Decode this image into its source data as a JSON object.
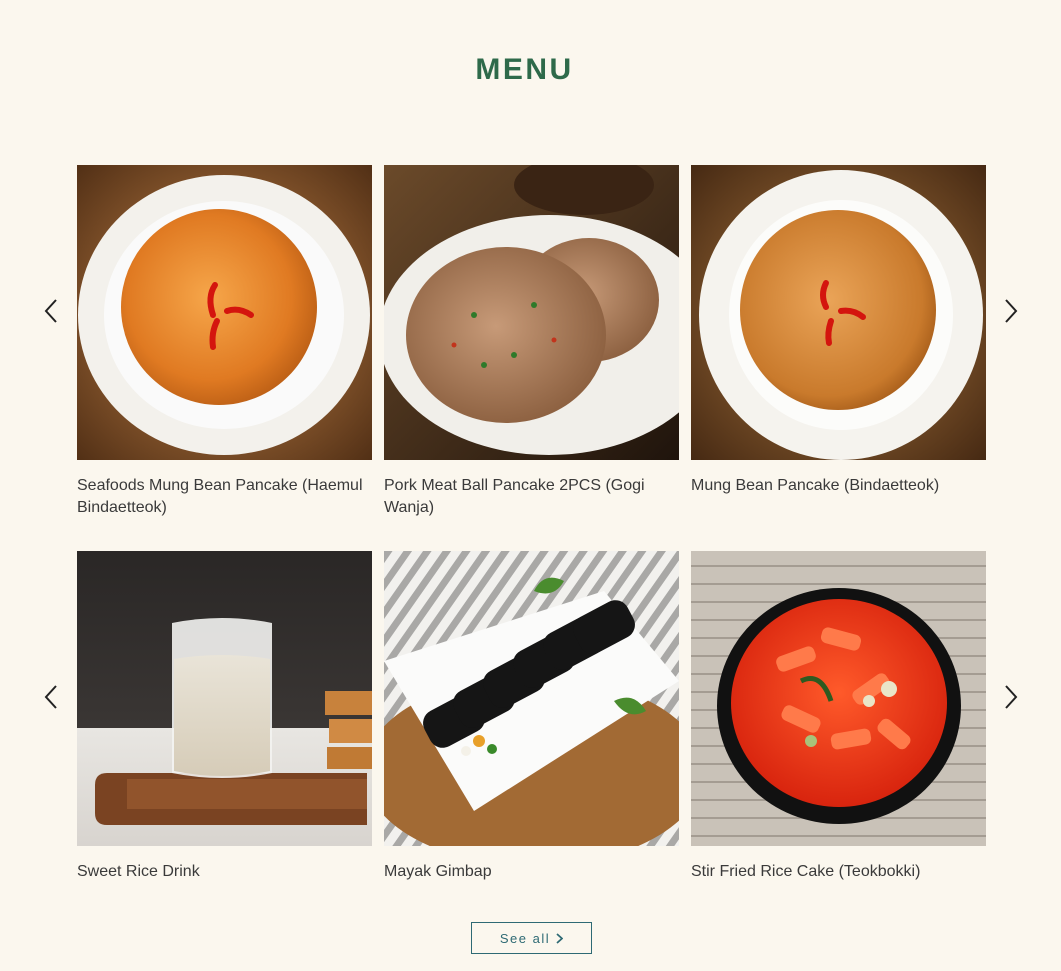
{
  "page": {
    "title": "MENU"
  },
  "carousels": [
    {
      "items": [
        {
          "title": "Seafoods Mung Bean Pancake (Haemul Bindaetteok)",
          "image": "seafood-pancake-photo"
        },
        {
          "title": "Pork Meat Ball Pancake 2PCS (Gogi Wanja)",
          "image": "meatball-pancake-photo"
        },
        {
          "title": "Mung Bean Pancake (Bindaetteok)",
          "image": "mung-bean-pancake-photo"
        }
      ]
    },
    {
      "items": [
        {
          "title": "Sweet Rice Drink",
          "image": "sweet-rice-drink-photo"
        },
        {
          "title": "Mayak Gimbap",
          "image": "mayak-gimbap-photo"
        },
        {
          "title": "Stir Fried Rice Cake (Teokbokki)",
          "image": "teokbokki-photo"
        }
      ]
    }
  ],
  "see_all": {
    "label": "See all",
    "icon": "chevron-right-icon"
  },
  "icons": {
    "prev": "chevron-left-icon",
    "next": "chevron-right-icon"
  },
  "colors": {
    "background": "#fbf7ee",
    "title": "#2e6a4a",
    "button_border": "#2e6a74",
    "text": "#3a3a3a"
  }
}
